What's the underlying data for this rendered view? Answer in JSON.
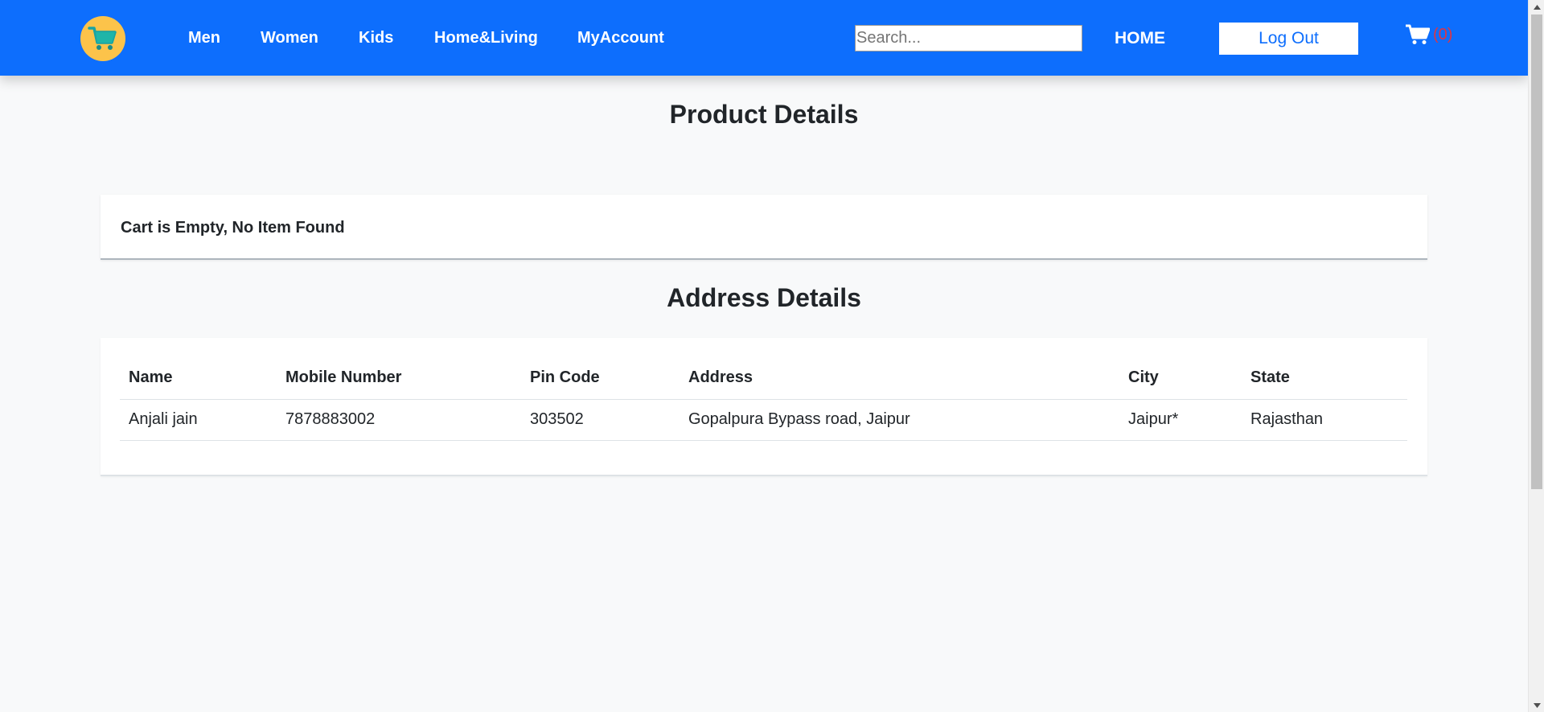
{
  "nav": {
    "logo_icon": "shopping-cart-logo-icon",
    "links": [
      "Men",
      "Women",
      "Kids",
      "Home&Living",
      "MyAccount"
    ],
    "search_placeholder": "Search...",
    "home_label": "HOME",
    "logout_label": "Log Out",
    "cart_icon": "cart-icon",
    "cart_count": "(0)"
  },
  "product_section": {
    "title": "Product Details",
    "empty_message": "Cart is Empty, No Item Found"
  },
  "address_section": {
    "title": "Address Details",
    "columns": [
      "Name",
      "Mobile Number",
      "Pin Code",
      "Address",
      "City",
      "State"
    ],
    "rows": [
      [
        "Anjali jain",
        "7878883002",
        "303502",
        "Gopalpura Bypass road, Jaipur",
        "Jaipur*",
        "Rajasthan"
      ]
    ]
  },
  "colors": {
    "navbar": "#0d6efd",
    "logo_bg": "#fcc34a",
    "cart_count": "#dc3545",
    "page_bg": "#f8f9fa"
  }
}
